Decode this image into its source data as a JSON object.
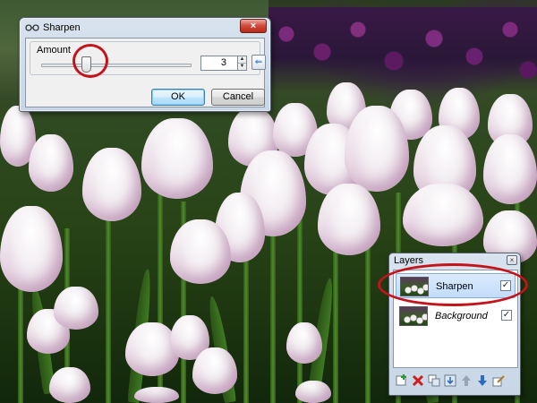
{
  "sharpen_dialog": {
    "title": "Sharpen",
    "close_label": "×",
    "amount_label": "Amount",
    "amount_value": "3",
    "slider_level": 0.3,
    "spin_up": "▲",
    "spin_down": "▼",
    "reset_icon": "reset-arrow-icon",
    "ok_label": "OK",
    "cancel_label": "Cancel"
  },
  "layers_panel": {
    "title": "Layers",
    "close_label": "×",
    "layers": [
      {
        "name": "Sharpen",
        "visible": true,
        "selected": true,
        "check": "✓"
      },
      {
        "name": "Background",
        "visible": true,
        "selected": false,
        "check": "✓"
      }
    ],
    "toolbar_icons": [
      "add-new-layer-icon",
      "delete-layer-icon",
      "duplicate-layer-icon",
      "merge-layer-down-icon",
      "move-layer-up-icon",
      "move-layer-down-icon",
      "layer-properties-icon"
    ]
  },
  "colors": {
    "annotation_circle": "#c4141a",
    "dialog_frame": "#c8d6e6",
    "selected_row": "#c1dcfc"
  }
}
